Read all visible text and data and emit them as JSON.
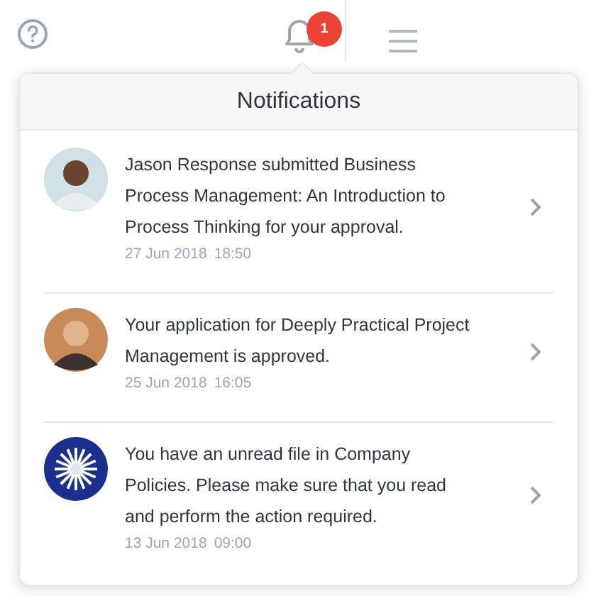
{
  "topbar": {
    "badge": "1"
  },
  "notifications": {
    "title": "Notifications",
    "items": [
      {
        "kind": "person",
        "text": "Jason Response submitted Business Process Management: An Introduction to Process Thinking for your approval.",
        "date": "27 Jun 2018",
        "time": "18:50"
      },
      {
        "kind": "person",
        "text": "Your application for Deeply Practical Project Management is approved.",
        "date": "25 Jun 2018",
        "time": "16:05"
      },
      {
        "kind": "logo",
        "text": "You have an unread file in Company Policies. Please make sure that you read and perform the action required.",
        "date": "13 Jun 2018",
        "time": "09:00"
      }
    ]
  }
}
